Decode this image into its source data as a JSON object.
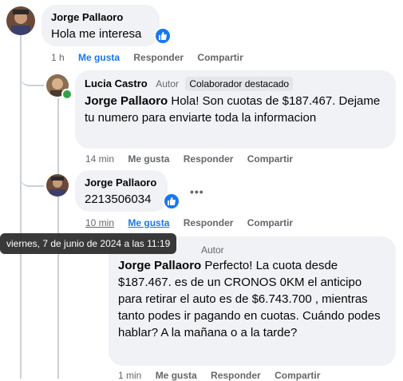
{
  "comments": [
    {
      "author": "Jorge Pallaoro",
      "text": "Hola me interesa",
      "time": "1 h",
      "like_label": "Me gusta",
      "reply_label": "Responder",
      "share_label": "Compartir"
    },
    {
      "author": "Lucia Castro",
      "author_tag": "Autor",
      "badge": "Colaborador destacado",
      "mention": "Jorge Pallaoro",
      "text": " Hola! Son cuotas de $187.467. Dejame tu numero para enviarte toda la informacion",
      "time": "14 min",
      "like_label": "Me gusta",
      "reply_label": "Responder",
      "share_label": "Compartir"
    },
    {
      "author": "Jorge Pallaoro",
      "text": "2213506034",
      "time": "10 min",
      "like_label": "Me gusta",
      "reply_label": "Responder",
      "share_label": "Compartir"
    },
    {
      "author_tag": "Autor",
      "mention": "Jorge Pallaoro",
      "text": " Perfecto! La cuota desde $187.467. es de un CRONOS 0KM el anticipo para retirar el auto es de $6.743.700 , mientras tanto podes ir pagando en cuotas. Cuándo podes hablar? A la mañana o a la tarde?",
      "time": "1 min",
      "like_label": "Me gusta",
      "reply_label": "Responder",
      "share_label": "Compartir"
    }
  ],
  "tooltip": "viernes, 7 de junio de 2024 a las 11:19",
  "more_label": "•••",
  "colors": {
    "accent": "#1877f2",
    "bubble": "#f0f2f5",
    "muted": "#65676b",
    "online": "#31a24c"
  }
}
